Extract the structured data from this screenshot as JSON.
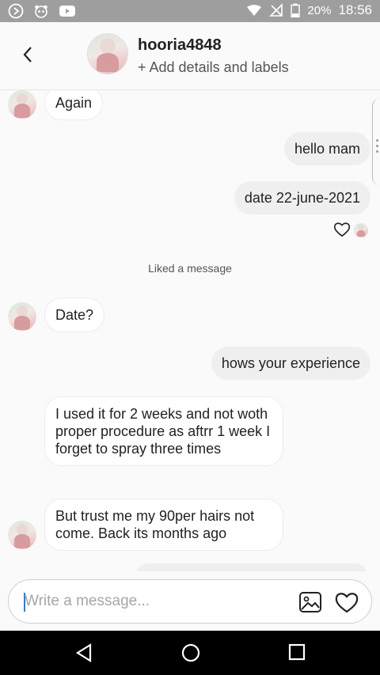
{
  "status_bar": {
    "battery_text": "20%",
    "time": "18:56",
    "icons": [
      "navigation-arrow-icon",
      "panda-icon",
      "youtube-icon",
      "wifi-icon",
      "no-signal-icon",
      "battery-icon"
    ]
  },
  "header": {
    "username": "hooria4848",
    "subtitle": "+ Add details and labels"
  },
  "messages": [
    {
      "side": "in",
      "text": "Again",
      "avatar": true
    },
    {
      "side": "out",
      "text": "hello mam"
    },
    {
      "side": "out",
      "text": "date 22-june-2021"
    },
    {
      "side": "out",
      "text": "hows your experience"
    },
    {
      "side": "in",
      "text": "Date?",
      "avatar": true
    },
    {
      "side": "in",
      "text": "I used it for 2 weeks and not woth proper procedure as aftrr 1 week I forget to spray three times",
      "avatar": false
    },
    {
      "side": "in",
      "text": "But trust me my 90per hairs not come. Back its months ago",
      "avatar": true
    }
  ],
  "system_note": "Liked a message",
  "composer": {
    "placeholder": "Write a message..."
  },
  "colors": {
    "status_bar": "#9e9e9e",
    "incoming_bubble": "#ffffff",
    "outgoing_bubble": "#efefef",
    "cursor": "#3a78c8",
    "nav_bar": "#000000"
  }
}
